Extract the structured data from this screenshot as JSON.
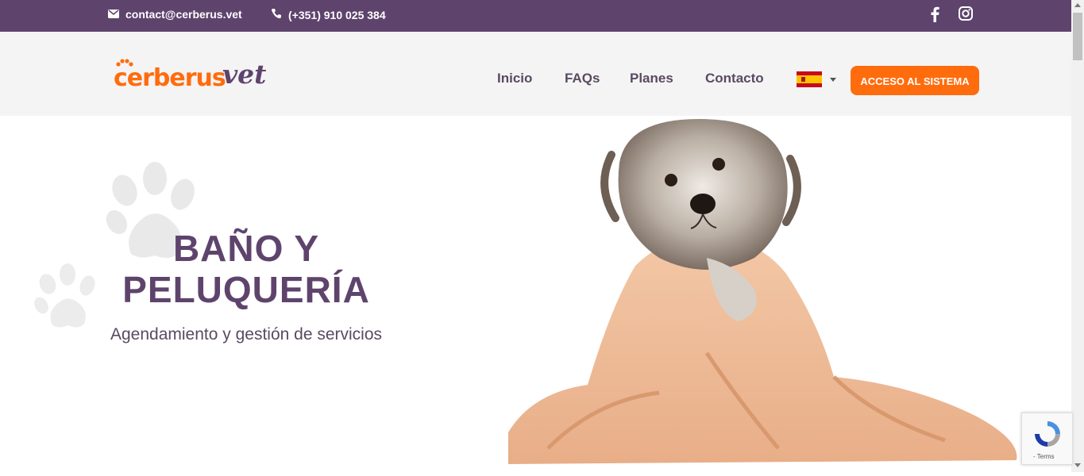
{
  "topbar": {
    "email": "contact@cerberus.vet",
    "phone": "(+351) 910 025 384",
    "icons": [
      "envelope-icon",
      "phone-icon",
      "facebook-icon",
      "instagram-icon"
    ]
  },
  "header": {
    "logo_text_orange": "cerberus",
    "logo_text_purple": "vet",
    "nav": [
      "Inicio",
      "FAQs",
      "Planes",
      "Contacto"
    ],
    "language": "ES",
    "access_button": "ACCESO AL SISTEMA"
  },
  "hero": {
    "title_line1": "BAÑO Y",
    "title_line2": "PELUQUERÍA",
    "subtitle": "Agendamiento y gestión de servicios"
  },
  "recaptcha": {
    "terms": "- Terms"
  },
  "colors": {
    "topbar": "#5e446d",
    "accent": "#ff6c0e",
    "title": "#5e446d",
    "header_bg": "#f4f4f4"
  }
}
